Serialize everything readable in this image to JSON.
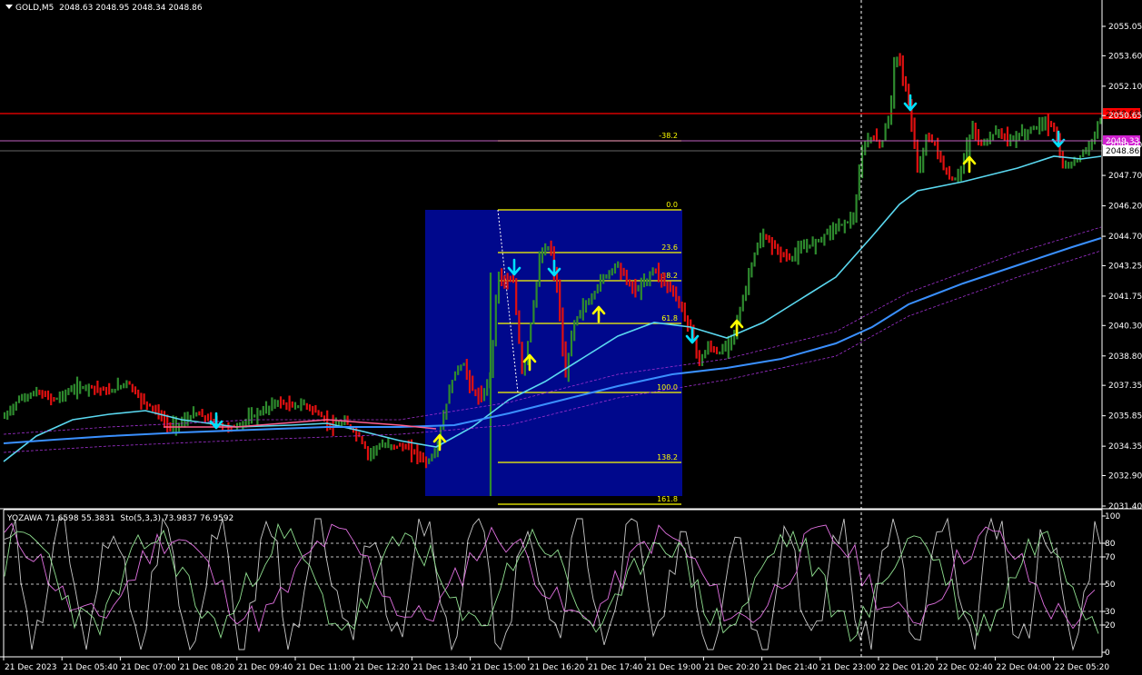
{
  "chart_header": {
    "symbol": "GOLD,M5",
    "ohlc": "2048.63 2048.95 2048.34 2048.86"
  },
  "indicator_header": {
    "yozawa": "YOZAWA 71.6598 55.3831",
    "stoch": "Sto(5,3,3) 73.9837 76.9592"
  },
  "price_axis": {
    "ticks": [
      "2055.05",
      "2053.60",
      "2052.10",
      "2050.65",
      "2049.20",
      "2047.70",
      "2046.20",
      "2044.70",
      "2043.25",
      "2041.75",
      "2040.30",
      "2038.80",
      "2037.35",
      "2035.85",
      "2034.35",
      "2032.90",
      "2031.40"
    ],
    "red_line_label": "2050.68",
    "magenta_line_label": "2049.33",
    "current_label": "2048.86"
  },
  "indicator_axis": {
    "ticks": [
      "100",
      "80",
      "70",
      "50",
      "30",
      "20",
      "0"
    ]
  },
  "time_axis": {
    "ticks": [
      "21 Dec 2023",
      "21 Dec 05:40",
      "21 Dec 07:00",
      "21 Dec 08:20",
      "21 Dec 09:40",
      "21 Dec 11:00",
      "21 Dec 12:20",
      "21 Dec 13:40",
      "21 Dec 15:00",
      "21 Dec 16:20",
      "21 Dec 17:40",
      "21 Dec 19:00",
      "21 Dec 20:20",
      "21 Dec 21:40",
      "21 Dec 23:00",
      "22 Dec 01:20",
      "22 Dec 02:40",
      "22 Dec 04:00",
      "22 Dec 05:20"
    ]
  },
  "fibonacci": {
    "levels": [
      "-38.2",
      "0.0",
      "23.6",
      "38.2",
      "61.8",
      "100.0",
      "138.2",
      "161.8"
    ]
  },
  "colors": {
    "background": "#000000",
    "bull": "#2e8b2e",
    "bear": "#e01010",
    "fib_box": "#00088c",
    "fib_line": "#ffff00",
    "ma_fast": "#5ad8f0",
    "ma_slow": "#3a90ff",
    "envelope": "#a030d0",
    "red_line": "#ff0000",
    "magenta_line": "#c060c0",
    "arrow_up": "#ffff00",
    "arrow_down": "#00e0ff",
    "stoch_main": "#c8c8c8",
    "stoch_signal": "#e070e0",
    "stoch_green": "#90e090"
  }
}
